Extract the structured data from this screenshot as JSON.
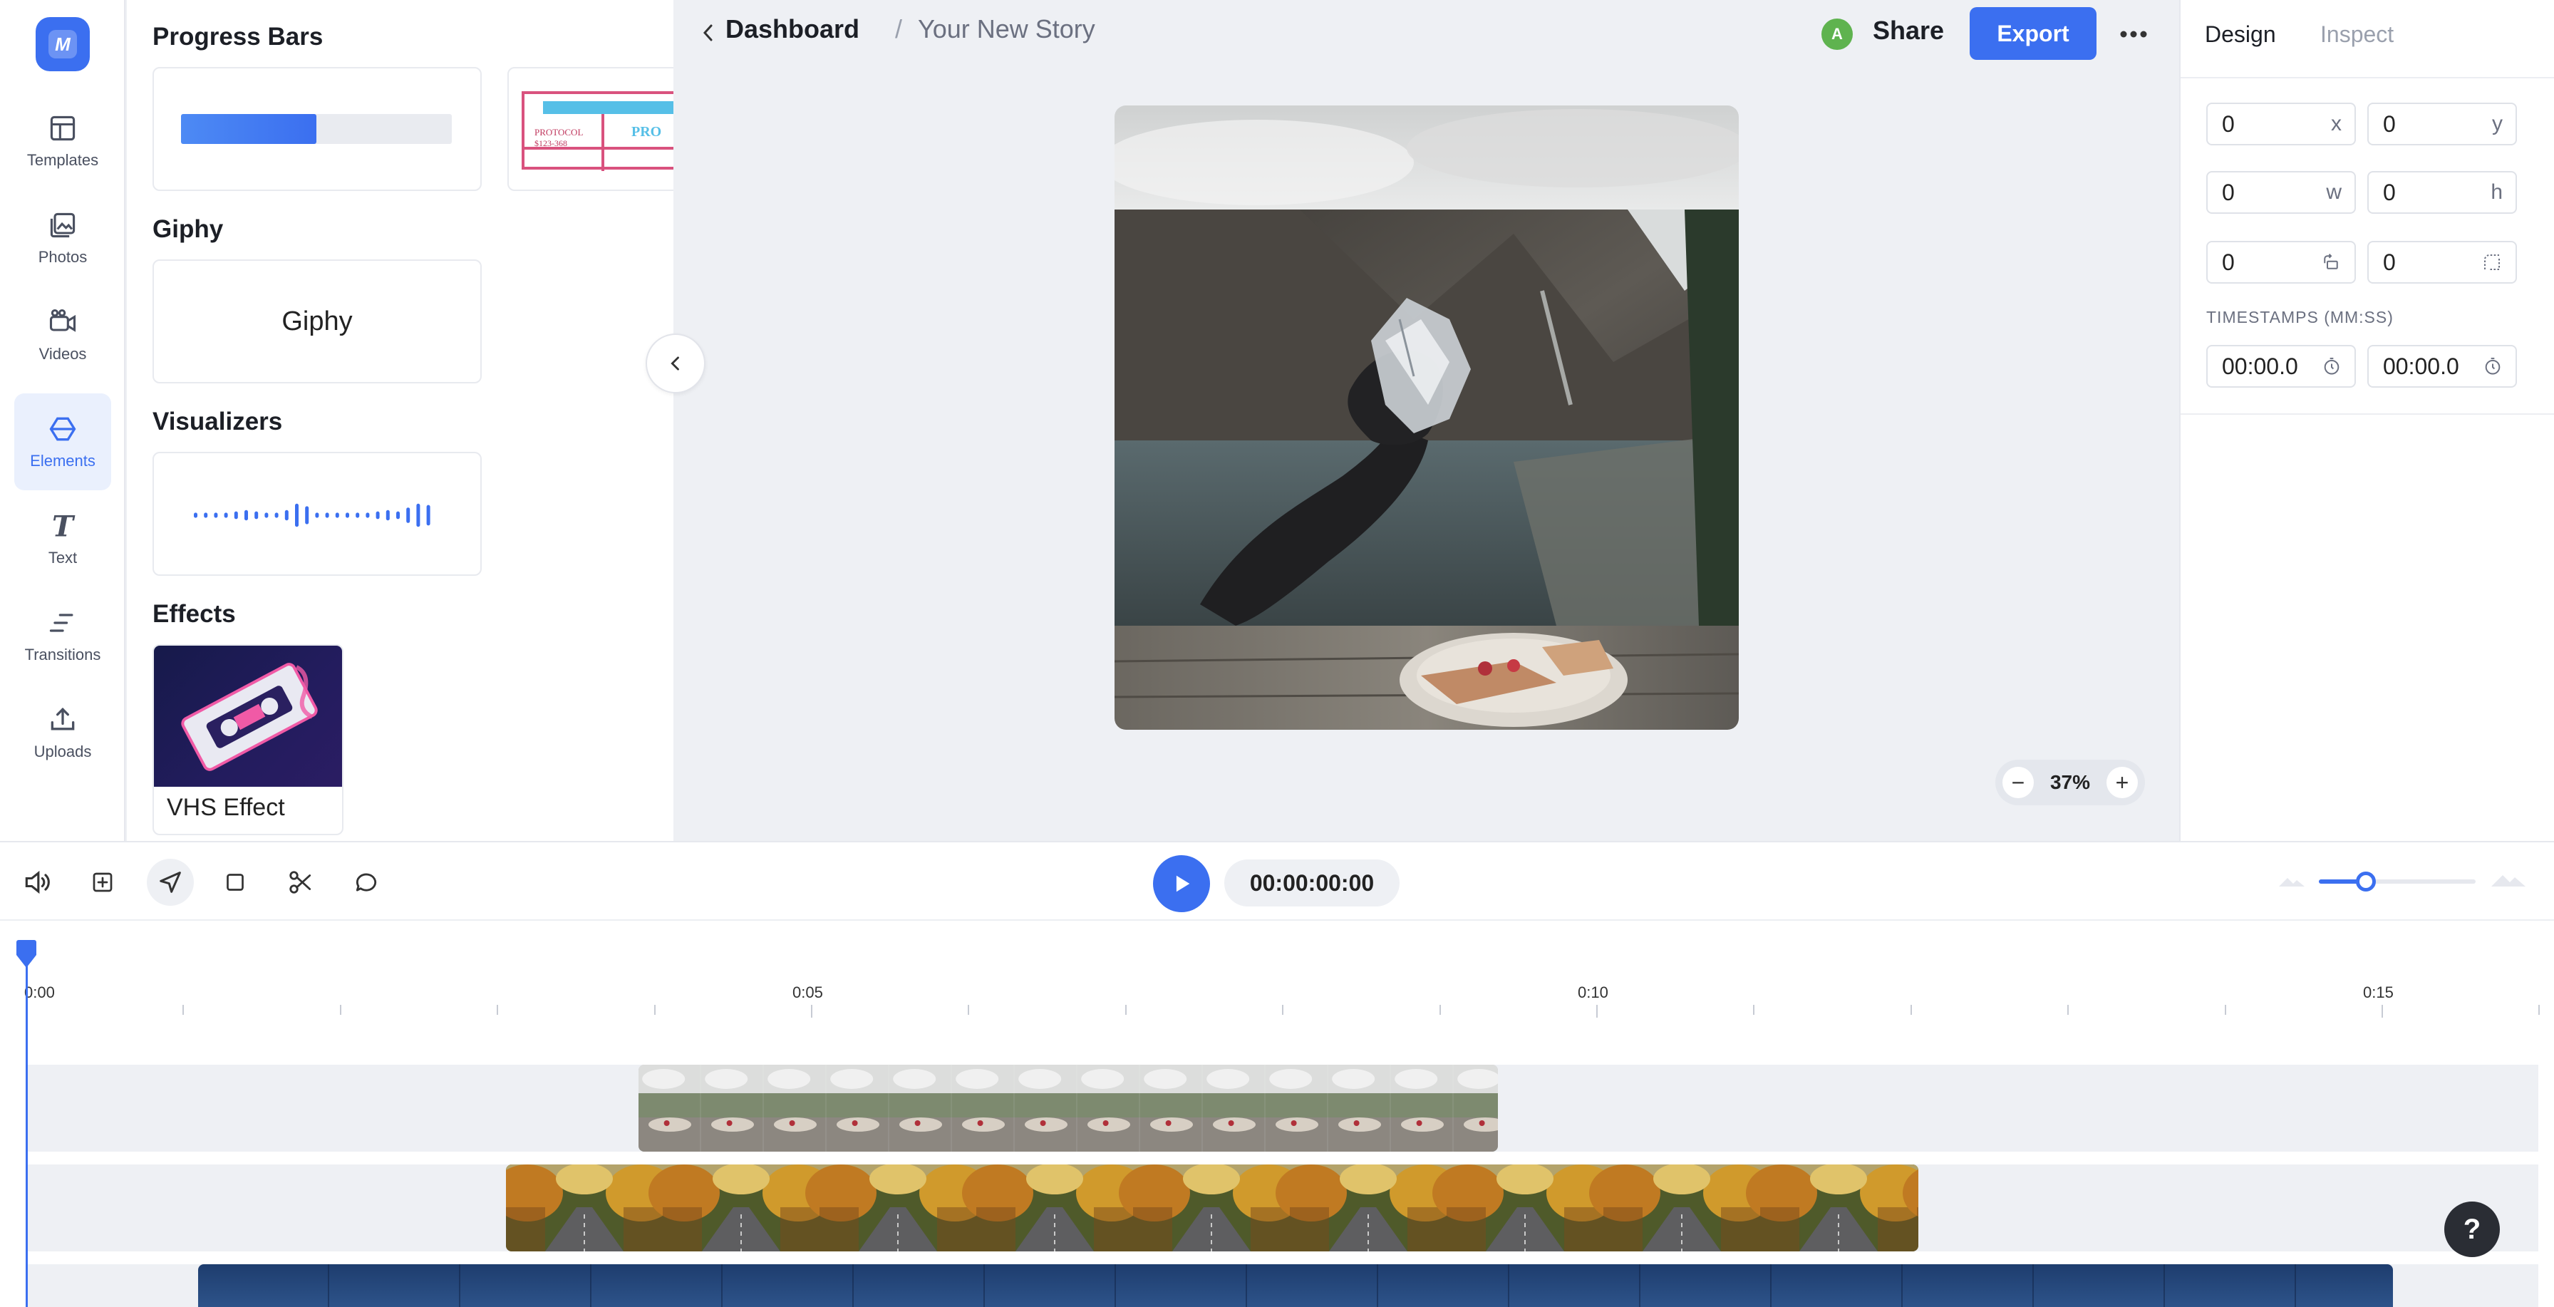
{
  "nav": {
    "items": [
      {
        "label": "Templates",
        "icon": "templates-icon"
      },
      {
        "label": "Photos",
        "icon": "photos-icon"
      },
      {
        "label": "Videos",
        "icon": "videos-icon"
      },
      {
        "label": "Elements",
        "icon": "elements-icon",
        "active": true
      },
      {
        "label": "Text",
        "icon": "text-icon"
      },
      {
        "label": "Transitions",
        "icon": "transitions-icon"
      },
      {
        "label": "Uploads",
        "icon": "uploads-icon"
      }
    ]
  },
  "elements_panel": {
    "progress_bars_title": "Progress Bars",
    "progress_fill": 0.5,
    "protocol_left": "PROTOCOL",
    "protocol_number": "$123-368",
    "protocol_right": "PRO",
    "giphy_title": "Giphy",
    "giphy_card": "Giphy",
    "visualizers_title": "Visualizers",
    "effects_title": "Effects",
    "vhs_label": "VHS Effect"
  },
  "header": {
    "dashboard": "Dashboard",
    "separator": "/",
    "story_title": "Your New Story",
    "avatar_initial": "A",
    "share": "Share",
    "export": "Export"
  },
  "zoom": {
    "value": "37%",
    "minus": "−",
    "plus": "+"
  },
  "inspector": {
    "tab_design": "Design",
    "tab_inspect": "Inspect",
    "x_value": "0",
    "x_label": "x",
    "y_value": "0",
    "y_label": "y",
    "w_value": "0",
    "w_label": "w",
    "h_value": "0",
    "h_label": "h",
    "rotate_value": "0",
    "radius_value": "0",
    "timestamps_label": "TIMESTAMPS (MM:SS)",
    "start_time": "00:00.0",
    "end_time": "00:00.0"
  },
  "timeline": {
    "timecode": "00:00:00:00",
    "ticks": [
      "0:00",
      "0:05",
      "0:10",
      "0:15"
    ],
    "zoom_level": 0.3
  },
  "colors": {
    "accent": "#3b6ff0",
    "avatar": "#5fb34f"
  },
  "help": "?"
}
